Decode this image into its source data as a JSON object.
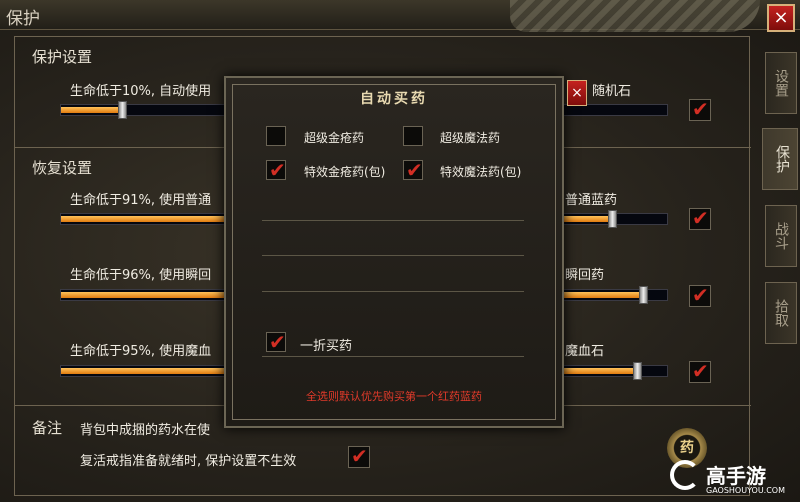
{
  "window": {
    "title": "保护",
    "close_icon": "×"
  },
  "tabs": [
    {
      "label": "设置"
    },
    {
      "label": "保护"
    },
    {
      "label": "战斗"
    },
    {
      "label": "拾取"
    }
  ],
  "protect": {
    "title": "保护设置",
    "item": {
      "label_left": "生命低于10%, 自动使用",
      "label_right": "随机石",
      "percent": 10,
      "checked": true
    }
  },
  "recover": {
    "title": "恢复设置",
    "items": [
      {
        "label_left": "生命低于91%, 使用普通",
        "label_right": "普通蓝药",
        "percent": 91,
        "checked": true
      },
      {
        "label_left": "生命低于96%, 使用瞬回",
        "label_right": "瞬回药",
        "percent": 96,
        "checked": true
      },
      {
        "label_left": "生命低于95%, 使用魔血",
        "label_right": "魔血石",
        "percent": 95,
        "checked": true
      }
    ]
  },
  "notes": {
    "title": "备注",
    "line1": "背包中成捆的药水在使",
    "line2": "复活戒指准备就绪时, 保护设置不生效",
    "line2_checked": true
  },
  "dialog": {
    "title": "自动买药",
    "close_icon": "×",
    "options": [
      {
        "label": "超级金疮药",
        "checked": false
      },
      {
        "label": "超级魔法药",
        "checked": false
      },
      {
        "label": "特效金疮药(包)",
        "checked": true
      },
      {
        "label": "特效魔法药(包)",
        "checked": true
      }
    ],
    "discount": {
      "label": "一折买药",
      "checked": true
    },
    "note": "全选则默认优先购买第一个红药蓝药"
  },
  "medicine_icon": {
    "label": "药"
  },
  "brand": {
    "name": "高手游",
    "sub": "GAOSHOUYOU.COM"
  },
  "colors": {
    "accent_red": "#d22e24",
    "slider_fill": "#f0961e",
    "note_red": "#e03a2a"
  }
}
